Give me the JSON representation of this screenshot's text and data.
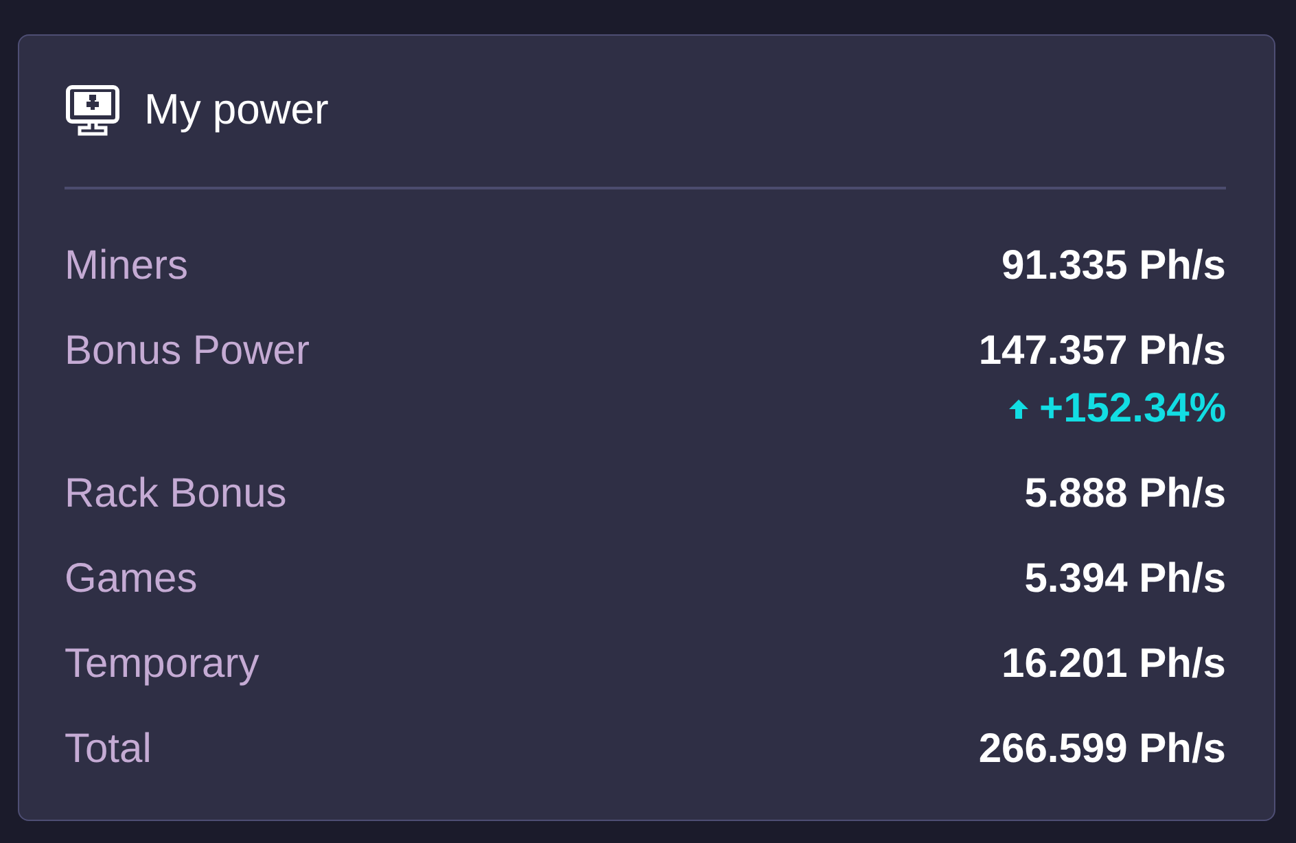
{
  "card": {
    "title": "My power"
  },
  "rows": [
    {
      "label": "Miners",
      "value": "91.335 Ph/s"
    },
    {
      "label": "Bonus Power",
      "value": "147.357 Ph/s",
      "change": {
        "rising": true,
        "text": "+152.34%"
      }
    },
    {
      "label": "Rack Bonus",
      "value": "5.888 Ph/s"
    },
    {
      "label": "Games",
      "value": "5.394 Ph/s"
    },
    {
      "label": "Temporary",
      "value": "16.201 Ph/s"
    },
    {
      "label": "Total",
      "value": "266.599 Ph/s"
    }
  ]
}
